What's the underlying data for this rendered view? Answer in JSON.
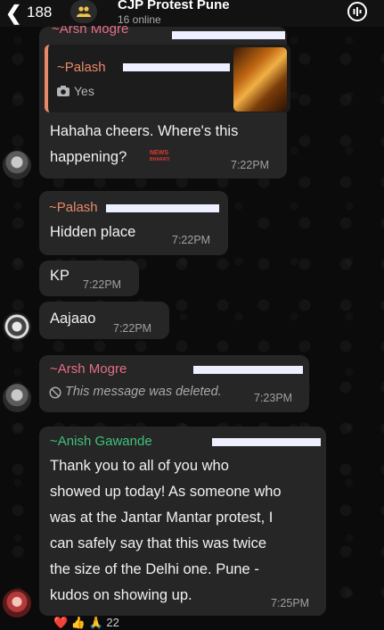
{
  "header": {
    "back_count": "188",
    "group_name": "CJP Protest Pune",
    "online_status": "16 online"
  },
  "messages": [
    {
      "sender": "~Arsh Mogre",
      "quote_sender": "~Palash",
      "quote_text": "Yes",
      "text_line1": "Hahaha cheers. Where's this",
      "text_line2": "happening?",
      "time": "7:22PM",
      "watermark_line1": "NEWS",
      "watermark_line2": "BHARATI"
    },
    {
      "sender": "~Palash",
      "text": "Hidden place",
      "time": "7:22PM"
    },
    {
      "text": "KP",
      "time": "7:22PM"
    },
    {
      "text": "Aajaao",
      "time": "7:22PM"
    },
    {
      "sender": "~Arsh Mogre",
      "text": "This message was deleted.",
      "time": "7:23PM"
    },
    {
      "sender": "~Anish Gawande",
      "lines": [
        "Thank you to all of you who",
        "showed up today! As someone who",
        "was at the Jantar Mantar protest, I",
        "can safely say that this was twice",
        "the size of the Delhi one. Pune -",
        "kudos on showing up."
      ],
      "time": "7:25PM"
    }
  ],
  "reactions": "❤️ 👍 🙏 22",
  "colors": {
    "palash": "#e9896a",
    "arsh": "#e56f84",
    "anish": "#3fc17a",
    "bubble": "#262626",
    "background": "#0b0b0b"
  }
}
